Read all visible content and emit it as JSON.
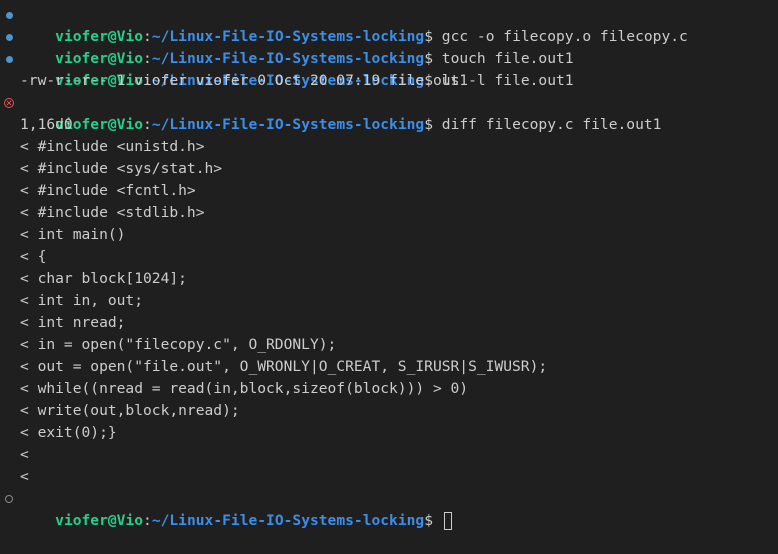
{
  "prompt": {
    "user_host": "viofer@Vio",
    "sep": ":",
    "path": "~/Linux-File-IO-Systems-locking",
    "symbol": "$"
  },
  "colors": {
    "background": "#1f1f1f",
    "text": "#cccccc",
    "user_host": "#23d18b",
    "path": "#3b8eea",
    "success_dot": "#4e94ce",
    "error_marker": "#f14c4c"
  },
  "commands": [
    {
      "status": "success",
      "text": " gcc -o filecopy.o filecopy.c"
    },
    {
      "status": "success",
      "text": " touch file.out1"
    },
    {
      "status": "success",
      "text": " ls -l file.out1"
    },
    {
      "status": "error",
      "text": " diff filecopy.c file.out1"
    },
    {
      "status": "pending",
      "text": " "
    }
  ],
  "ls_output": "-rw-r--r-- 1 viofer viofer 0 Oct 20 07:19 file.out1",
  "diff_output": [
    "1,16d0",
    "< #include <unistd.h>",
    "< #include <sys/stat.h>",
    "< #include <fcntl.h>",
    "< #include <stdlib.h>",
    "< int main()",
    "< {",
    "< char block[1024];",
    "< int in, out;",
    "< int nread;",
    "< in = open(\"filecopy.c\", O_RDONLY);",
    "< out = open(\"file.out\", O_WRONLY|O_CREAT, S_IRUSR|S_IWUSR);",
    "< while((nread = read(in,block,sizeof(block))) > 0)",
    "< write(out,block,nread);",
    "< exit(0);}",
    "<",
    "<"
  ]
}
